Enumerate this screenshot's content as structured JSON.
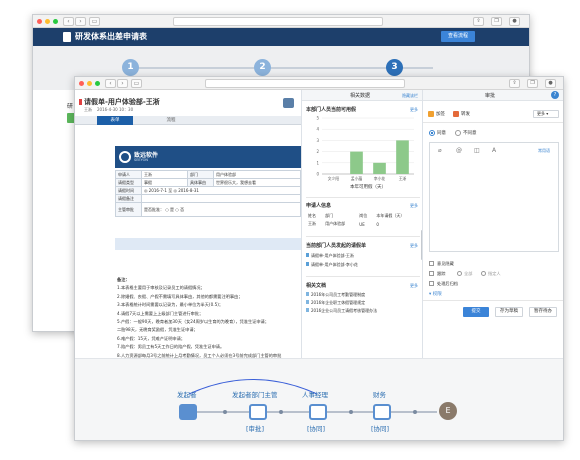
{
  "back_window": {
    "title": "研发体系出差申请表",
    "approve_btn": "查看流程",
    "steps": [
      "1",
      "2",
      "3"
    ],
    "side_text": "研"
  },
  "front_window": {
    "doc_title": "请假单-用户体验部-王淅",
    "author": "王淅",
    "date": "2016-4-30 10：30",
    "tabs": [
      "表单",
      "流程"
    ],
    "logo_name": "致远软件",
    "logo_sub": "SEEYON",
    "form_rows": [
      {
        "label": "申请人",
        "value": "王淅",
        "label2": "部门",
        "value2": "用户体验部"
      },
      {
        "label": "请假类型",
        "value": "事假",
        "label2": "具体事由",
        "value2": "世界很乐大，我想去看"
      },
      {
        "label": "请假时间",
        "value": "◎ 2016-7-1 至 ◎ 2016-8-31",
        "label2": "",
        "value2": ""
      },
      {
        "label": "请假备注",
        "value": "",
        "label2": "",
        "value2": ""
      },
      {
        "label": "主管审批",
        "value": "是否批准：  ○  是        ○  否",
        "label2": "",
        "value2": ""
      }
    ],
    "notes": [
      "备注：",
      "1.本表格主要用于审核及记录员工的请假情况；",
      "2.除婚假、丧假、产假不需填写具体事由，其他的都需要注明事由；",
      "3.本表格统计时间需要以记录为，最小单位为半天(0.5)；",
      "4.请假7天以上需要上上级部门主管进行审批；",
      "5.产假：一般90天，晚育者加30天（女24周岁以生育的为晚育），凭准生证申请；",
      "   二胎98天，无晚育奖励假，凭准生证申请；",
      "6.难产假：15天，凭难产证明申请；",
      "7.陪产假：男员工有5天工作日的陪产假，凭准生证申请。",
      "8.人力资源部每月3号之前统计上月考勤情况，员工个人必须在3号前完成部门主管的审批"
    ]
  },
  "related_panel": {
    "title": "相关数据",
    "header_link": "隐藏该栏",
    "chart_section": "本部门人员当前可用假",
    "chart_more": "更多",
    "people_section": "申请人信息",
    "people_more": "更多",
    "people_headers": [
      "姓名",
      "部门",
      "岗位",
      "本年请假（天）"
    ],
    "people_row": [
      "王淅",
      "用户体验部",
      "UE",
      "0"
    ],
    "pending_section": "当前部门人员发起的请假单",
    "pending_more": "更多",
    "pending_items": [
      "请假单-用户体验部-王淅",
      "请假单-用户体验部-李小花"
    ],
    "docs_section": "相关文档",
    "docs_more": "更多",
    "docs_items": [
      "2016年公司员工考勤管理制度",
      "2016年企业职工休假管理规定",
      "2016企业公司员工请假考核管理办法"
    ]
  },
  "chart_data": {
    "type": "bar",
    "categories": [
      "文少阳",
      "孟小蕴",
      "李小花",
      "王淅"
    ],
    "values": [
      0,
      2,
      1,
      3
    ],
    "xlabel": "本年可用假（天）",
    "ylabel": "",
    "ylim": [
      0,
      5
    ],
    "yticks": [
      "5",
      "4",
      "3",
      "2",
      "1",
      "0"
    ],
    "bar_color": "#8dc98a"
  },
  "approval_panel": {
    "title": "审批",
    "help": "?",
    "add_sign": "加签",
    "notify": "转发",
    "more": "更多",
    "agree": "同意",
    "disagree": "不同意",
    "common_words": "常用语",
    "tracking": "意见隐藏",
    "track_opts": [
      "跟踪",
      "全部",
      "指定人"
    ],
    "process_opt": "处理后归档",
    "permission": "权限",
    "submit": "提交",
    "save_wait": "存为草稿",
    "pause": "暂存待办"
  },
  "flow": {
    "nodes": [
      {
        "name": "发起者",
        "tag": ""
      },
      {
        "name": "发起者部门主管",
        "tag": "[审批]"
      },
      {
        "name": "人事经理",
        "tag": "[协同]"
      },
      {
        "name": "财务",
        "tag": "[协同]"
      },
      {
        "name": "E",
        "tag": ""
      }
    ]
  }
}
